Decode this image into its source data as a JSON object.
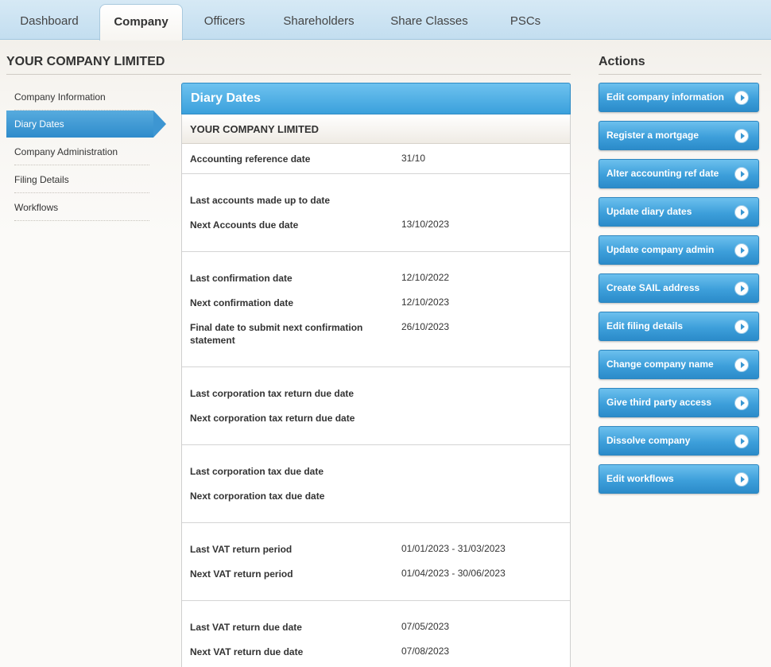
{
  "nav": {
    "tabs": [
      {
        "label": "Dashboard"
      },
      {
        "label": "Company"
      },
      {
        "label": "Officers"
      },
      {
        "label": "Shareholders"
      },
      {
        "label": "Share Classes"
      },
      {
        "label": "PSCs"
      }
    ],
    "active": "Company"
  },
  "company_name": "YOUR COMPANY LIMITED",
  "sidebar": {
    "items": [
      {
        "label": "Company Information"
      },
      {
        "label": "Diary Dates"
      },
      {
        "label": "Company Administration"
      },
      {
        "label": "Filing Details"
      },
      {
        "label": "Workflows"
      }
    ],
    "active": "Diary Dates"
  },
  "panel": {
    "title": "Diary Dates",
    "subtitle": "YOUR COMPANY LIMITED",
    "rows": [
      {
        "label": "Accounting reference date",
        "value": "31/10"
      },
      {
        "label": "Last accounts made up to date",
        "value": ""
      },
      {
        "label": "Next Accounts due date",
        "value": "13/10/2023"
      },
      {
        "label": "Last confirmation date",
        "value": "12/10/2022"
      },
      {
        "label": "Next confirmation date",
        "value": "12/10/2023"
      },
      {
        "label": "Final date to submit next confirmation statement",
        "value": "26/10/2023"
      },
      {
        "label": "Last corporation tax return due date",
        "value": ""
      },
      {
        "label": "Next corporation tax return due date",
        "value": ""
      },
      {
        "label": "Last corporation tax due date",
        "value": ""
      },
      {
        "label": "Next corporation tax due date",
        "value": ""
      },
      {
        "label": "Last VAT return period",
        "value": "01/01/2023 - 31/03/2023"
      },
      {
        "label": "Next VAT return period",
        "value": "01/04/2023 - 30/06/2023"
      },
      {
        "label": "Last VAT return due date",
        "value": "07/05/2023"
      },
      {
        "label": "Next VAT return due date",
        "value": "07/08/2023"
      }
    ]
  },
  "actions": {
    "title": "Actions",
    "items": [
      {
        "label": "Edit company information"
      },
      {
        "label": "Register a mortgage"
      },
      {
        "label": "Alter accounting ref date"
      },
      {
        "label": "Update diary dates"
      },
      {
        "label": "Update company admin"
      },
      {
        "label": "Create SAIL address"
      },
      {
        "label": "Edit filing details"
      },
      {
        "label": "Change company name"
      },
      {
        "label": "Give third party access"
      },
      {
        "label": "Dissolve company"
      },
      {
        "label": "Edit workflows"
      }
    ]
  },
  "colors": {
    "accent": "#3aa0dc",
    "nav_bg": "#c3def0"
  }
}
